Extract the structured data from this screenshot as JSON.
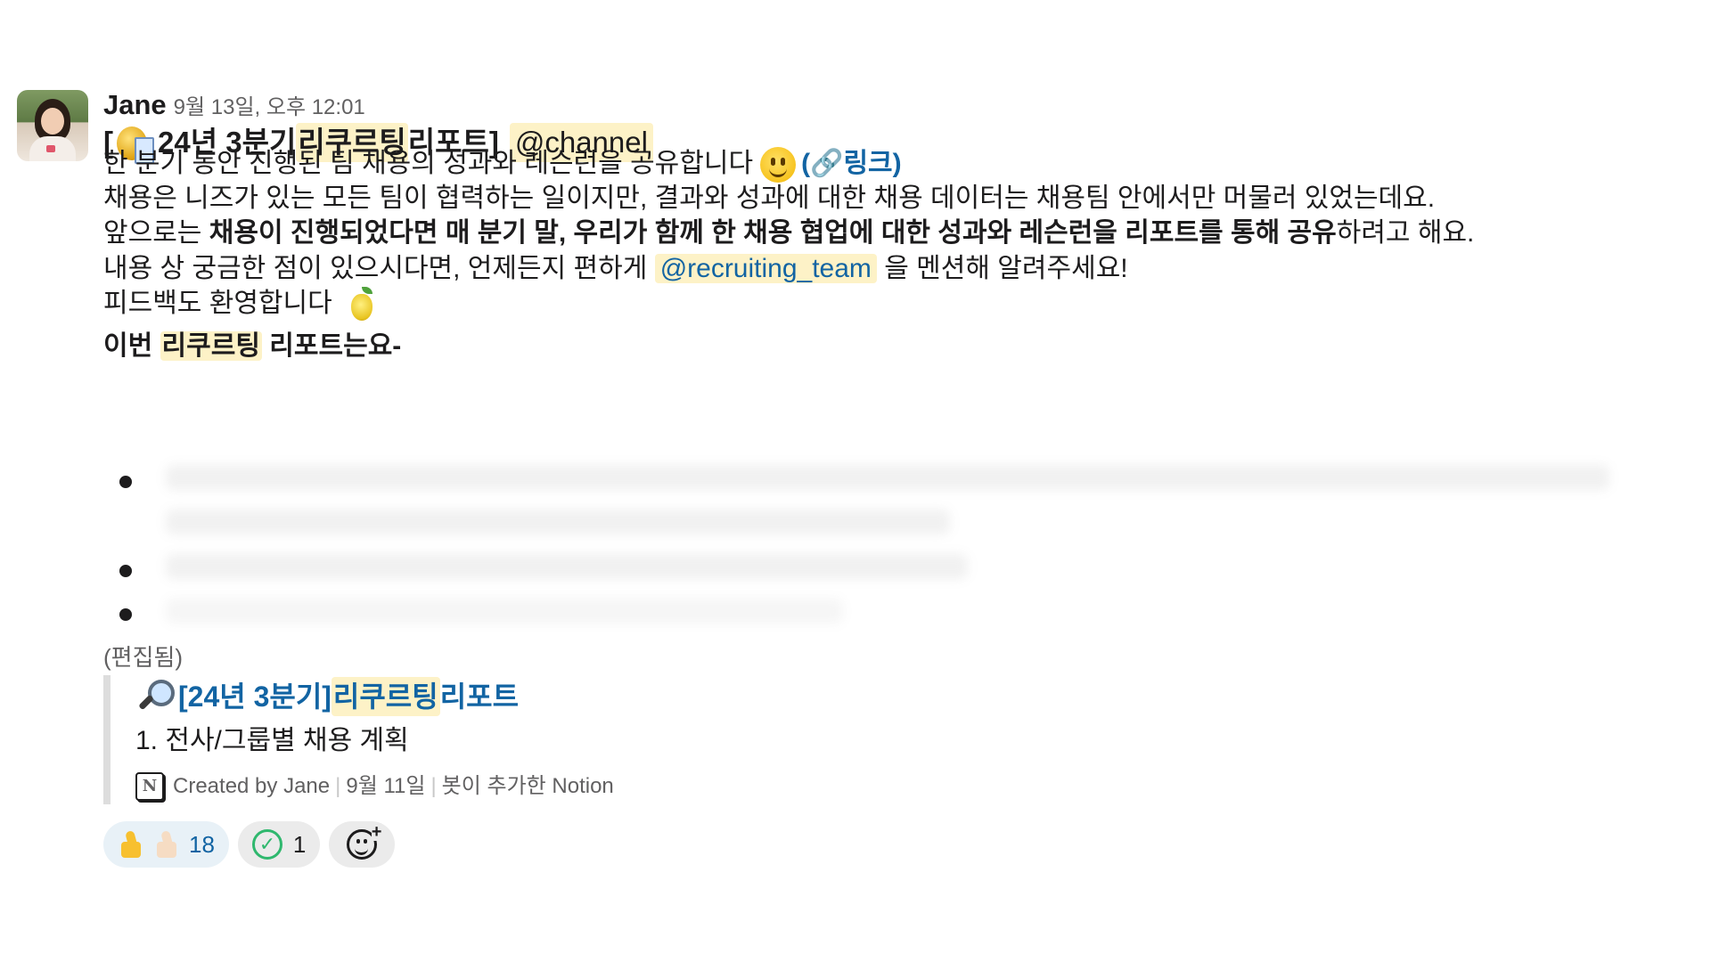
{
  "message": {
    "sender": "Jane",
    "timestamp": "9월 13일, 오후 12:01",
    "title": {
      "open_bracket": "[",
      "part1": "24년 3분기 ",
      "highlight": "리쿠르팅",
      "part2": " 리포트]",
      "mention": "@channel"
    },
    "line1": {
      "text": "한 분기 동안 진행된 팀 채용의 성과와 레슨런을 공유합니다",
      "link_open": "(",
      "link_label": "링크",
      "link_close": ")"
    },
    "line2": "채용은 니즈가 있는 모든 팀이 협력하는 일이지만, 결과와 성과에 대한 채용 데이터는 채용팀 안에서만 머물러 있었는데요.",
    "line3": {
      "pre": "앞으로는 ",
      "bold": "채용이 진행되었다면 매 분기 말, 우리가 함께 한 채용 협업에 대한 성과와 레슨런을 리포트를 통해 공유",
      "post": "하려고 해요."
    },
    "line4": {
      "pre": "내용 상 궁금한 점이 있으시다면, 언제든지 편하게 ",
      "mention": "@recruiting_team",
      "post": " 을 멘션해 알려주세요!"
    },
    "line5": "피드백도 환영합니다",
    "section_heading": {
      "pre": "이번 ",
      "highlight": "리쿠르팅",
      "post": " 리포트는요-"
    },
    "edited_label": "(편집됨)",
    "attachment": {
      "title_pre": "[24년 3분기] ",
      "title_highlight": "리쿠르팅",
      "title_post": " 리포트",
      "subtitle": "1. 전사/그룹별 채용 계획",
      "created_by": "Created by Jane",
      "date": "9월 11일",
      "source": "봇이 추가한 Notion",
      "notion_letter": "N"
    },
    "reactions": [
      {
        "icons": [
          "thumbs-up-icon",
          "thumbs-up-light-icon"
        ],
        "count": "18"
      },
      {
        "icons": [
          "check-circle-icon"
        ],
        "count": "1"
      }
    ]
  },
  "colors": {
    "link": "#1264a3",
    "highlight": "#fdf2c7",
    "reaction_bg": "#e8f1f7",
    "text": "#1d1c1d",
    "muted": "#616061"
  }
}
